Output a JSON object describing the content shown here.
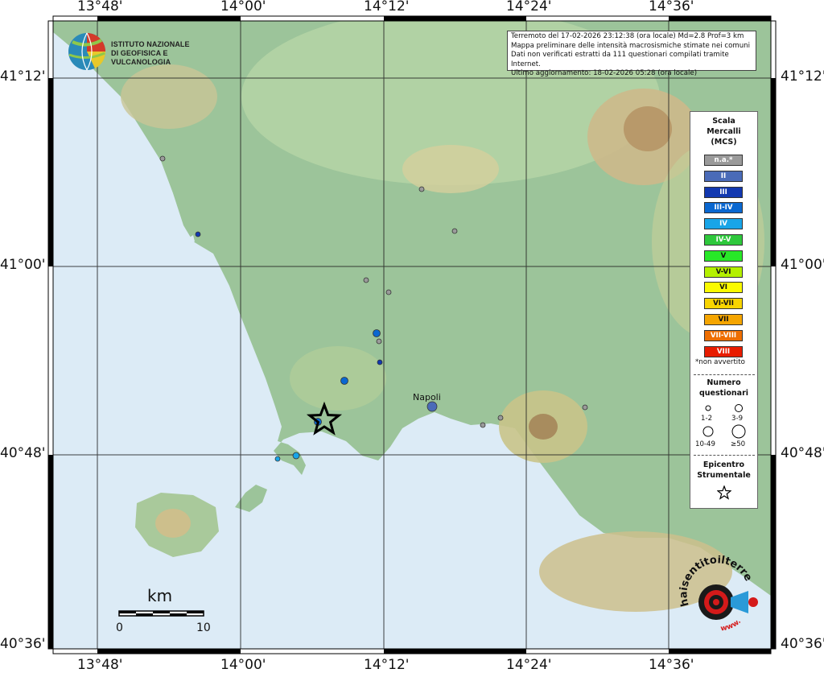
{
  "map": {
    "lon_ticks": [
      "13°48'",
      "14°00'",
      "14°12'",
      "14°24'",
      "14°36'"
    ],
    "lat_ticks": [
      "41°12'",
      "41°00'",
      "40°48'",
      "40°36'"
    ],
    "city_label": "Napoli",
    "scale": {
      "unit": "km",
      "min": "0",
      "max": "10"
    }
  },
  "logo": {
    "line1": "ISTITUTO NAZIONALE",
    "line2": "DI GEOFISICA E VULCANOLOGIA"
  },
  "info": {
    "line1": "Terremoto del 17-02-2026 23:12:38 (ora locale) Md=2.8 Prof=3 km",
    "line2": "Mappa preliminare delle intensità macrosismiche stimate nei comuni",
    "line3": "Dati non verificati estratti da 111 questionari compilati tramite Internet.",
    "line4": "Ultimo aggiornamento: 18-02-2026 05:28 (ora locale)"
  },
  "legend": {
    "title1": "Scala",
    "title2": "Mercalli",
    "title3": "(MCS)",
    "levels": [
      {
        "label": "n.a.*",
        "color": "#9a9a9a"
      },
      {
        "label": "II",
        "color": "#4a6bb8"
      },
      {
        "label": "III",
        "color": "#1238b0"
      },
      {
        "label": "III-IV",
        "color": "#0a67d0"
      },
      {
        "label": "IV",
        "color": "#18a5e8"
      },
      {
        "label": "IV-V",
        "color": "#2ec83c"
      },
      {
        "label": "V",
        "color": "#28e828"
      },
      {
        "label": "V-VI",
        "color": "#b4f000"
      },
      {
        "label": "VI",
        "color": "#fafa00"
      },
      {
        "label": "VI-VII",
        "color": "#f8d400"
      },
      {
        "label": "VII",
        "color": "#f5a500"
      },
      {
        "label": "VII-VIII",
        "color": "#ee6e00"
      },
      {
        "label": "VIII",
        "color": "#e81c00"
      }
    ],
    "note": "*non avvertito",
    "count_title1": "Numero",
    "count_title2": "questionari",
    "counts": [
      "1-2",
      "3-9",
      "10-49",
      "≥50"
    ],
    "epi_title1": "Epicentro",
    "epi_title2": "Strumentale"
  },
  "badge": {
    "text": "haisentitoilterremoto.it",
    "prefix": "www."
  }
}
